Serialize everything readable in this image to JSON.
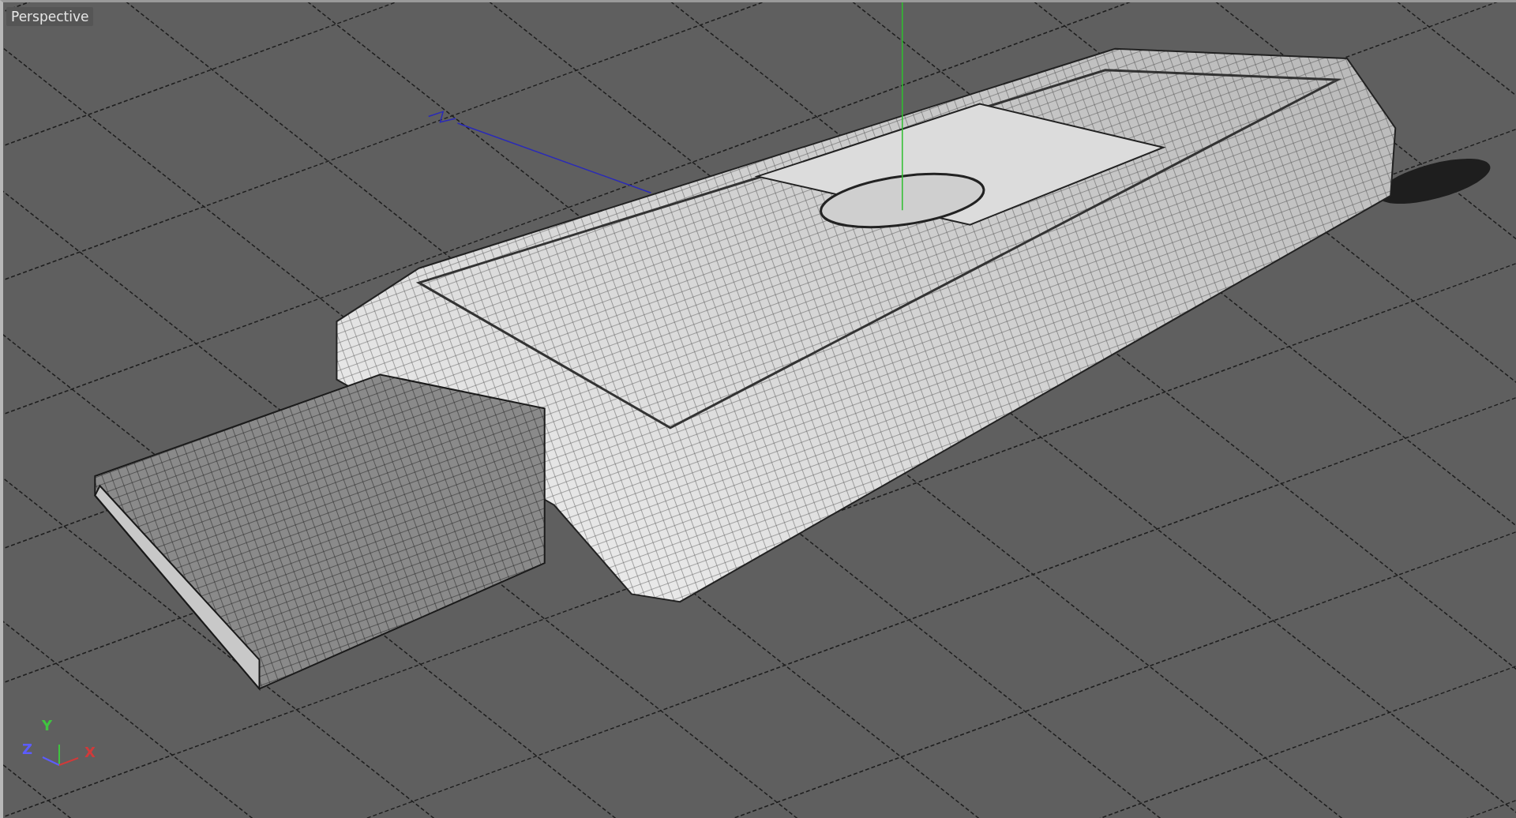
{
  "viewport": {
    "label": "Perspective"
  },
  "axis_gizmo": {
    "axes": [
      {
        "label": "Y",
        "color": "#3fc43f"
      },
      {
        "label": "Z",
        "color": "#5c5cff"
      },
      {
        "label": "X",
        "color": "#d03a3a"
      }
    ]
  }
}
